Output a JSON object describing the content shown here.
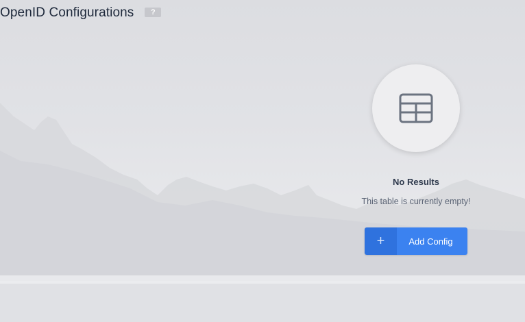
{
  "header": {
    "title": "OpenID Configurations",
    "help_label": "?"
  },
  "empty_state": {
    "icon": "table-icon",
    "title": "No Results",
    "message": "This table is currently empty!"
  },
  "add_button": {
    "icon": "plus-icon",
    "icon_glyph": "+",
    "label": "Add Config"
  },
  "colors": {
    "primary": "#3b82f0",
    "primary_dark": "#2f72de",
    "title_text": "#1f2a3c",
    "background": "#e2e3e7"
  }
}
